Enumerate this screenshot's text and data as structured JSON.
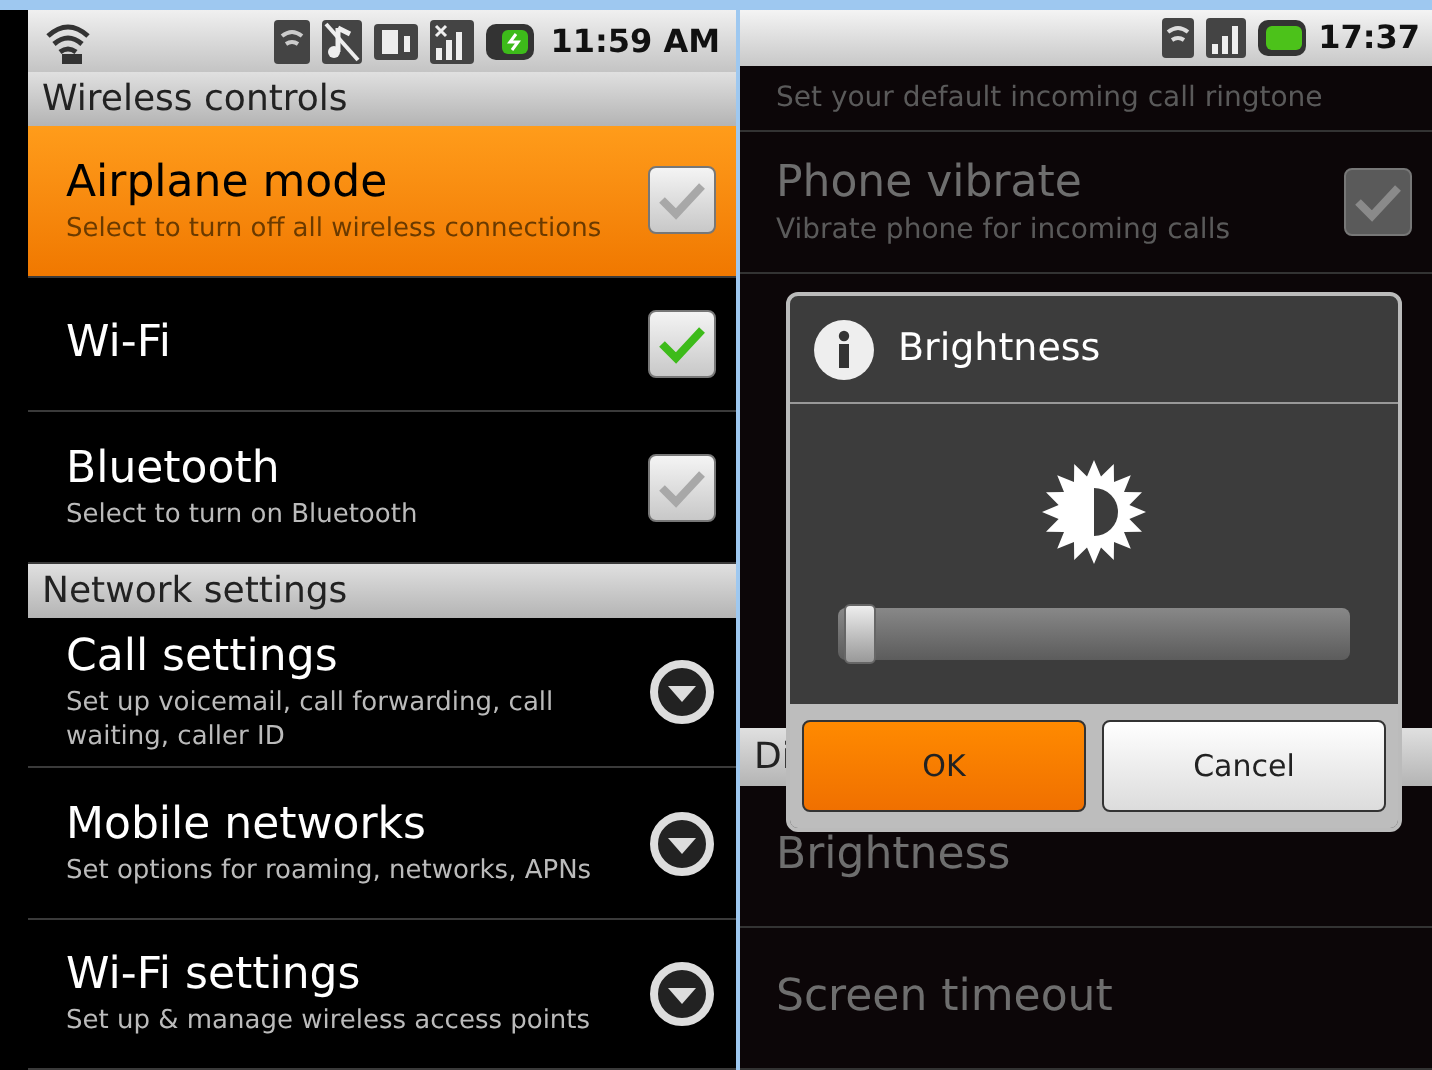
{
  "left_phone": {
    "status_bar": {
      "time": "11:59 AM"
    },
    "sections": [
      {
        "header": "Wireless controls",
        "items": [
          {
            "title": "Airplane mode",
            "subtitle": "Select to turn off all wireless connections",
            "kind": "checkbox",
            "checked": false,
            "selected": true
          },
          {
            "title": "Wi-Fi",
            "kind": "checkbox",
            "checked": true,
            "selected": false
          },
          {
            "title": "Bluetooth",
            "subtitle": "Select to turn on Bluetooth",
            "kind": "checkbox",
            "checked": false,
            "selected": false
          }
        ]
      },
      {
        "header": "Network settings",
        "items": [
          {
            "title": "Call settings",
            "subtitle": "Set up voicemail, call forwarding, call waiting, caller ID",
            "kind": "submenu",
            "selected": false
          },
          {
            "title": "Mobile networks",
            "subtitle": "Set options for roaming, networks, APNs",
            "kind": "submenu",
            "selected": false
          },
          {
            "title": "Wi-Fi settings",
            "subtitle": "Set up & manage wireless access points",
            "kind": "submenu",
            "selected": false
          }
        ]
      }
    ]
  },
  "right_phone": {
    "status_bar": {
      "time": "17:37"
    },
    "top_items": [
      {
        "subtitle": "Set your default incoming call ringtone"
      },
      {
        "title": "Phone vibrate",
        "subtitle": "Vibrate phone for incoming calls",
        "checked": true
      }
    ],
    "section_header": "Di",
    "bottom_items": [
      {
        "title": "Brightness"
      },
      {
        "title": "Screen timeout"
      }
    ],
    "dialog": {
      "title": "Brightness",
      "slider": {
        "level": 0.02
      },
      "buttons": [
        {
          "label": "OK",
          "selected": true
        },
        {
          "label": "Cancel",
          "selected": false
        }
      ]
    }
  }
}
